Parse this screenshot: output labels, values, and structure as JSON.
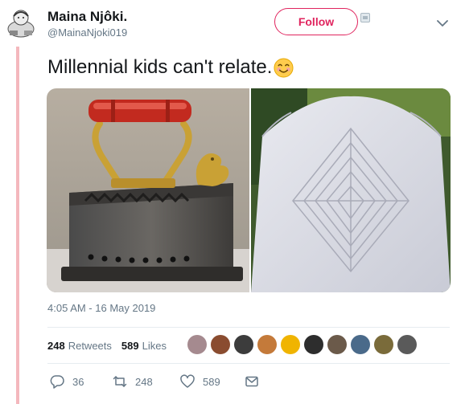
{
  "user": {
    "name": "Maina Njôki.",
    "handle": "@MainaNjoki019"
  },
  "follow_label": "Follow",
  "tweet": {
    "text": "Millennial kids can't relate.",
    "timestamp": "4:05 AM - 16 May 2019"
  },
  "stats": {
    "retweets_count": "248",
    "retweets_label": "Retweets",
    "likes_count": "589",
    "likes_label": "Likes"
  },
  "likers": [
    {
      "color": "#a58a8f"
    },
    {
      "color": "#8a4c30"
    },
    {
      "color": "#3c3c3c"
    },
    {
      "color": "#c47a3a"
    },
    {
      "color": "#f0b400"
    },
    {
      "color": "#2d2d2d"
    },
    {
      "color": "#6b5a4a"
    },
    {
      "color": "#4a6a8a"
    },
    {
      "color": "#7a6b3a"
    },
    {
      "color": "#5a5a5a"
    }
  ],
  "actions": {
    "reply_count": "36",
    "retweet_count": "248",
    "like_count": "589"
  },
  "colors": {
    "accent": "#e0245e",
    "rail": "#f4b8bd",
    "muted": "#657786"
  },
  "icons": {
    "reply": "reply-icon",
    "retweet": "retweet-icon",
    "like": "heart-icon",
    "dm": "envelope-icon",
    "chevron": "chevron-down-icon"
  }
}
